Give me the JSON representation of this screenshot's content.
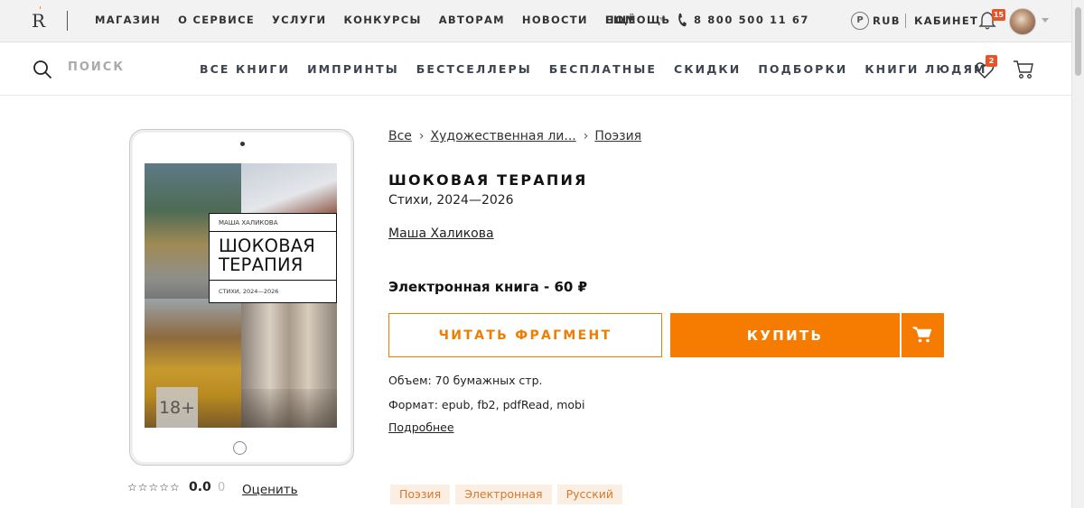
{
  "logo": {
    "letter": "R",
    "accent": "'"
  },
  "topbar": {
    "nav": [
      "МАГАЗИН",
      "О СЕРВИСЕ",
      "УСЛУГИ",
      "КОНКУРСЫ",
      "АВТОРАМ",
      "НОВОСТИ",
      "ЕЩЁ"
    ],
    "help": "ПОМОЩЬ",
    "phone": "8 800 500 11 67",
    "currency_symbol": "P",
    "currency": "RUB",
    "cabinet": "КАБИНЕТ",
    "notifications": "15"
  },
  "navbar": {
    "search_placeholder": "ПОИСК",
    "items": [
      "ВСЕ КНИГИ",
      "ИМПРИНТЫ",
      "БЕСТСЕЛЛЕРЫ",
      "БЕСПЛАТНЫЕ",
      "СКИДКИ",
      "ПОДБОРКИ",
      "КНИГИ ЛЮДЯМ"
    ],
    "favorites_count": "2"
  },
  "cover": {
    "author": "МАША ХАЛИКОВА",
    "title": "ШОКОВАЯ ТЕРАПИЯ",
    "subtitle": "СТИХИ, 2024—2026",
    "age": "18+"
  },
  "rating": {
    "stars": "☆☆☆☆☆",
    "value": "0.0",
    "count": "0",
    "rate_label": "Оценить"
  },
  "breadcrumbs": [
    "Все",
    "Художественная ли...",
    "Поэзия"
  ],
  "breadcrumb_sep": "›",
  "book": {
    "title": "ШОКОВАЯ ТЕРАПИЯ",
    "subtitle": "Стихи, 2024—2026",
    "author": "Маша Халикова",
    "price": "Электронная книга - 60 ₽",
    "read_label": "ЧИТАТЬ ФРАГМЕНТ",
    "buy_label": "КУПИТЬ",
    "volume": "Объем: 70 бумажных стр.",
    "format": "Формат: epub, fb2, pdfRead, mobi",
    "more": "Подробнее",
    "tags": [
      "Поэзия",
      "Электронная",
      "Русский"
    ]
  },
  "colors": {
    "accent": "#f57c00",
    "badge": "#e8542a",
    "tag_bg": "#fbeee3",
    "tag_text": "#d9782a"
  },
  "icons": [
    "search-icon",
    "phone-icon",
    "bell-icon",
    "heart-icon",
    "cart-icon",
    "chevron-down-icon"
  ]
}
